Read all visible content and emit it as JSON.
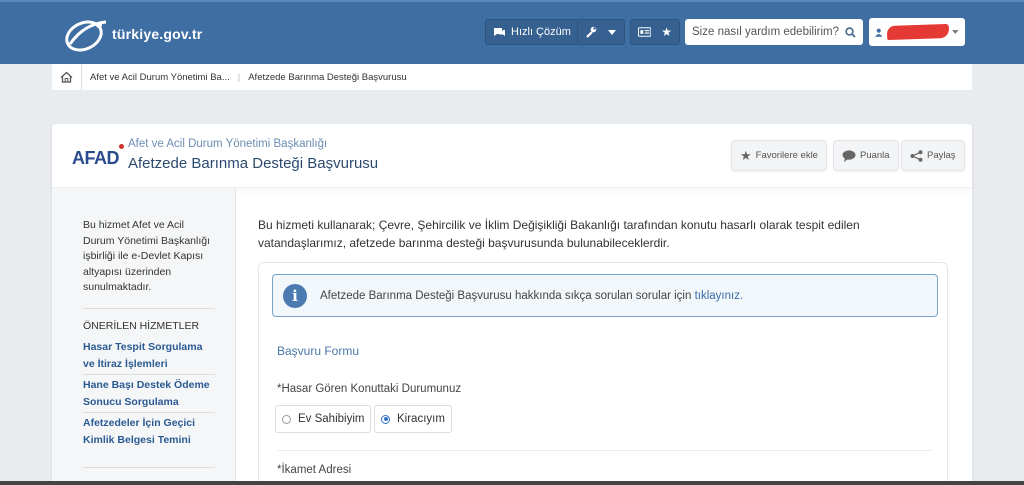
{
  "header": {
    "logo_text": "türkiye.gov.tr",
    "quick_solution_label": "Hızlı Çözüm",
    "search_placeholder": "Size nasıl yardım edebilirim?",
    "brand_color": "#3f6ea2"
  },
  "breadcrumb": {
    "items": [
      "Afet ve Acil Durum Yönetimi Ba...",
      "Afetzede Barınma Desteği Başvurusu"
    ]
  },
  "page_header": {
    "agency_logo": "AFAD",
    "institution": "Afet ve Acil Durum Yönetimi Başkanlığı",
    "title": "Afetzede Barınma Desteği Başvurusu",
    "actions": {
      "favorites": "Favorilere ekle",
      "rate": "Puanla",
      "share": "Paylaş"
    }
  },
  "sidebar": {
    "intro": "Bu hizmet Afet ve Acil Durum Yönetimi Başkanlığı işbirliği ile e-Devlet Kapısı altyapısı üzerinden sunulmaktadır.",
    "recommended_heading": "ÖNERİLEN HİZMETLER",
    "links": [
      "Hasar Tespit Sorgulama ve İtiraz İşlemleri",
      "Hane Başı Destek Ödeme Sonucu Sorgulama",
      "Afetzedeler İçin Geçici Kimlik Belgesi Temini"
    ]
  },
  "content": {
    "lead": "Bu hizmeti kullanarak; Çevre, Şehircilik ve İklim Değişikliği Bakanlığı tarafından konutu hasarlı olarak tespit edilen vatandaşlarımız, afetzede barınma desteği başvurusunda bulunabileceklerdir.",
    "info_text": "Afetzede Barınma Desteği Başvurusu hakkında sıkça sorulan sorular için",
    "info_link": "tıklayınız.",
    "form_title": "Başvuru Formu",
    "status_label": "*Hasar Gören Konuttaki Durumunuz",
    "options": [
      "Ev Sahibiyim",
      "Kiracıyım"
    ],
    "selected_option": "Kiracıyım",
    "address_label": "*İkamet Adresi"
  }
}
